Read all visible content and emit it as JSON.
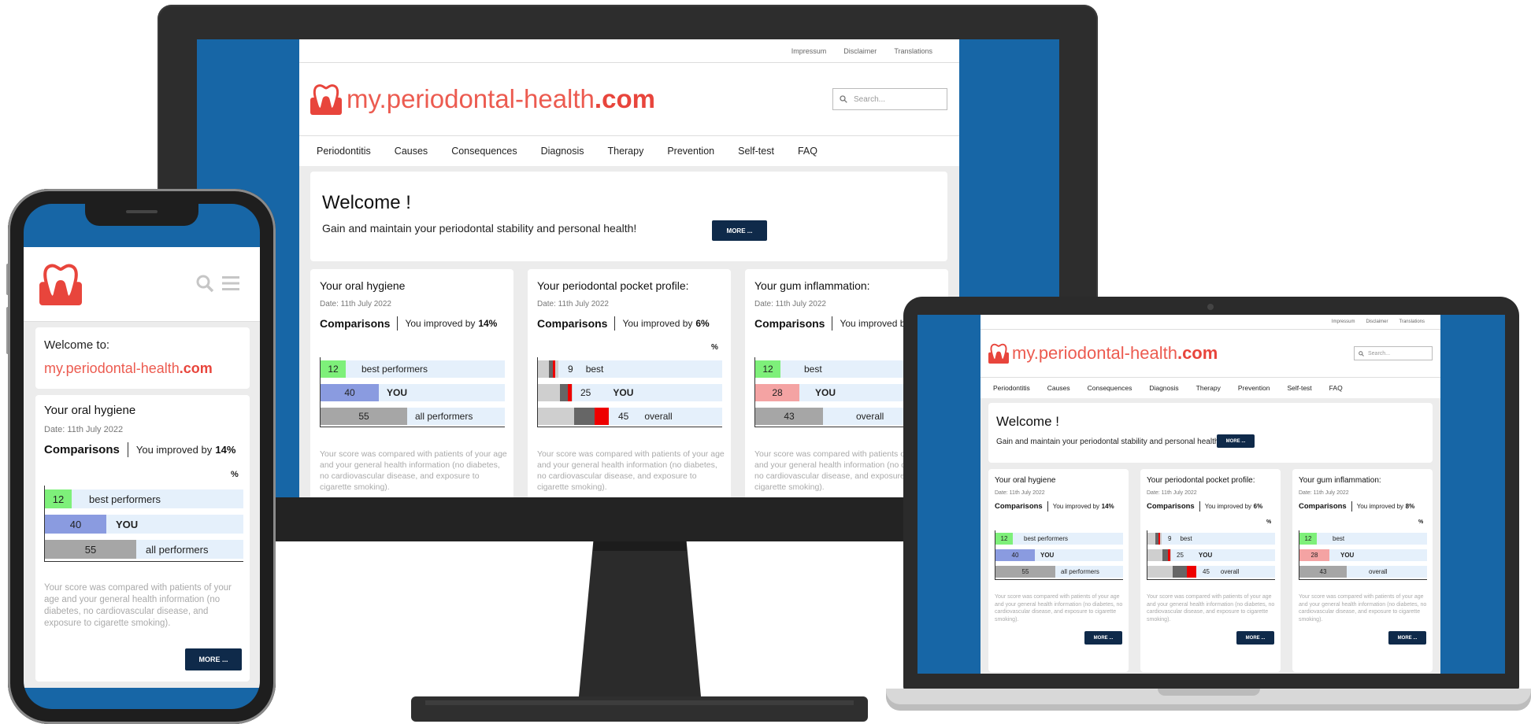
{
  "brand": {
    "my": "my.",
    "name": "periodontal-health",
    "com": ".com"
  },
  "top_links": [
    "Impressum",
    "Disclaimer",
    "Translations"
  ],
  "search": {
    "placeholder": "Search..."
  },
  "nav": [
    "Periodontitis",
    "Causes",
    "Consequences",
    "Diagnosis",
    "Therapy",
    "Prevention",
    "Self-test",
    "FAQ"
  ],
  "welcome": {
    "title": "Welcome !",
    "subtitle": "Gain and maintain your periodontal stability and personal health!",
    "button": "MORE ..."
  },
  "cards": [
    {
      "title": "Your oral hygiene",
      "date": "Date: 11th July 2022",
      "comparisons": "Comparisons",
      "improved_prefix": "You improved by",
      "improved_value": "14%",
      "percent_sign": "%",
      "rows": [
        {
          "value": "12",
          "label": "best performers",
          "color": "#7ef07a",
          "bold": false
        },
        {
          "value": "40",
          "label": "YOU",
          "color": "#8a9be0",
          "bold": true
        },
        {
          "value": "55",
          "label": "all performers",
          "color": "#a6a6a6",
          "bold": false
        }
      ],
      "note": "Your score was compared with patients of your age and your general health information (no diabetes, no cardiovascular disease, and exposure to cigarette smoking).",
      "button": "MORE ..."
    },
    {
      "title": "Your periodontal pocket profile:",
      "date": "Date: 11th July 2022",
      "comparisons": "Comparisons",
      "improved_prefix": "You improved by",
      "improved_value": "6%",
      "percent_sign": "%",
      "rows": [
        {
          "value": "9",
          "label": "best",
          "bold": false
        },
        {
          "value": "25",
          "label": "YOU",
          "bold": true
        },
        {
          "value": "45",
          "label": "overall",
          "bold": false
        }
      ],
      "note": "Your score was compared with patients of your age and your general health information (no diabetes, no cardiovascular disease, and exposure to cigarette smoking).",
      "button": "MORE ..."
    },
    {
      "title": "Your gum inflammation:",
      "date": "Date: 11th July 2022",
      "comparisons": "Comparisons",
      "improved_prefix": "You improved by",
      "improved_value": "8%",
      "percent_sign": "%",
      "rows": [
        {
          "value": "12",
          "label": "best",
          "color": "#7ef07a",
          "bold": false
        },
        {
          "value": "28",
          "label": "YOU",
          "color": "#f4a3a3",
          "bold": true
        },
        {
          "value": "43",
          "label": "overall",
          "color": "#a6a6a6",
          "bold": false
        }
      ],
      "note": "Your score was compared with patients of your age and your general health information (no diabetes, no cardiovascular disease, and exposure to cigarette smoking).",
      "button": "MORE ..."
    }
  ],
  "mobile": {
    "welcome_label": "Welcome to:"
  },
  "colors": {
    "device_screen_blue": "#1766a6",
    "brand_red": "#e8453c",
    "button_navy": "#0f2a4a",
    "bar_bg": "#e5f0fb"
  }
}
